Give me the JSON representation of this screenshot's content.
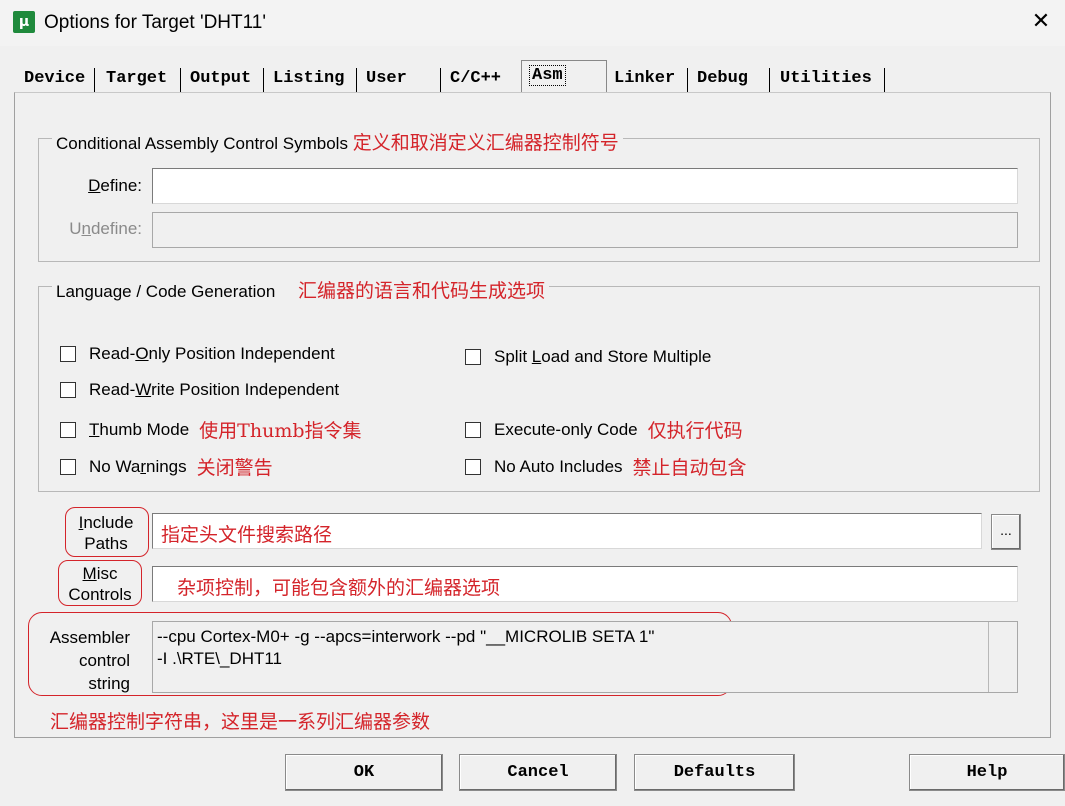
{
  "window": {
    "icon_glyph": "μ",
    "title": "Options for Target 'DHT11'",
    "close": "✕"
  },
  "tabs": [
    {
      "label": "Device"
    },
    {
      "label": "Target"
    },
    {
      "label": "Output"
    },
    {
      "label": "Listing"
    },
    {
      "label": "User"
    },
    {
      "label": "C/C++"
    },
    {
      "label": "Asm",
      "active": true
    },
    {
      "label": "Linker"
    },
    {
      "label": "Debug"
    },
    {
      "label": "Utilities"
    }
  ],
  "conditional": {
    "legend": "Conditional Assembly Control Symbols",
    "annotation": "定义和取消定义汇编器控制符号",
    "define_label_pre": "",
    "define_label_u": "D",
    "define_label_post": "efine:",
    "define_value": "",
    "undefine_label_pre": "U",
    "undefine_label_u": "n",
    "undefine_label_post": "define:",
    "undefine_value": ""
  },
  "language": {
    "legend": "Language / Code Generation",
    "annotation": "汇编器的语言和代码生成选项",
    "options": {
      "ro": {
        "pre": "Read-",
        "u": "O",
        "post": "nly Position Independent",
        "checked": false
      },
      "rw": {
        "pre": "Read-",
        "u": "W",
        "post": "rite Position Independent",
        "checked": false
      },
      "thumb": {
        "pre": "",
        "u": "T",
        "post": "humb Mode",
        "checked": false,
        "annotation": "使用Thumb指令集"
      },
      "nowarn": {
        "pre": "No Wa",
        "u": "r",
        "post": "nings",
        "checked": false,
        "annotation": "关闭警告"
      },
      "split": {
        "pre": "Split ",
        "u": "L",
        "post": "oad and Store Multiple",
        "checked": false
      },
      "xo": {
        "pre": "Execute-only Code",
        "u": "",
        "post": "",
        "checked": false,
        "annotation": "仅执行代码"
      },
      "noauto": {
        "pre": "No Auto Includes",
        "u": "",
        "post": "",
        "checked": false,
        "annotation": "禁止自动包含"
      }
    }
  },
  "include": {
    "label_line1": "Include",
    "label_line2": "Paths",
    "value": "指定头文件搜索路径",
    "browse": "..."
  },
  "misc": {
    "label_line1": "Misc",
    "label_line2": "Controls",
    "value": "杂项控制，可能包含额外的汇编器选项"
  },
  "asm_string": {
    "label_line1": "Assembler",
    "label_line2": "control",
    "label_line3": "string",
    "line1": "--cpu Cortex-M0+ -g --apcs=interwork --pd \"__MICROLIB SETA 1\"",
    "line2": "-I .\\RTE\\_DHT11",
    "annotation": "汇编器控制字符串，这里是一系列汇编器参数"
  },
  "buttons": {
    "ok": "OK",
    "cancel": "Cancel",
    "defaults": "Defaults",
    "help": "Help"
  },
  "colors": {
    "annotation_red": "#d4242a",
    "window_bg": "#f0f0f0"
  }
}
